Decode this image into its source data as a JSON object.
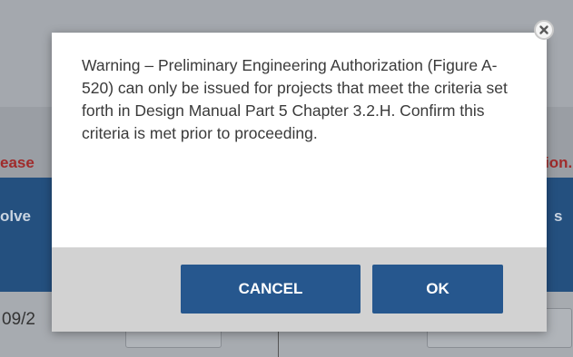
{
  "background": {
    "left_warning_fragment": "ease",
    "right_warning_fragment": "ion.",
    "left_header_fragment": "olve",
    "right_header_fragment": "s",
    "row_date_fragment": "09/2"
  },
  "dialog": {
    "message": "Warning – Preliminary Engineering Authorization (Figure A-520) can only be issued for projects that meet the criteria set forth in Design Manual Part 5 Chapter 3.2.H. Confirm this criteria is met prior to proceeding.",
    "cancel_label": "CANCEL",
    "ok_label": "OK",
    "close_icon": "close-icon"
  },
  "colors": {
    "button_bg": "#26578e",
    "footer_bg": "#d2d2d2",
    "header_bg": "#24507f",
    "warning_red": "#a02b2b"
  }
}
